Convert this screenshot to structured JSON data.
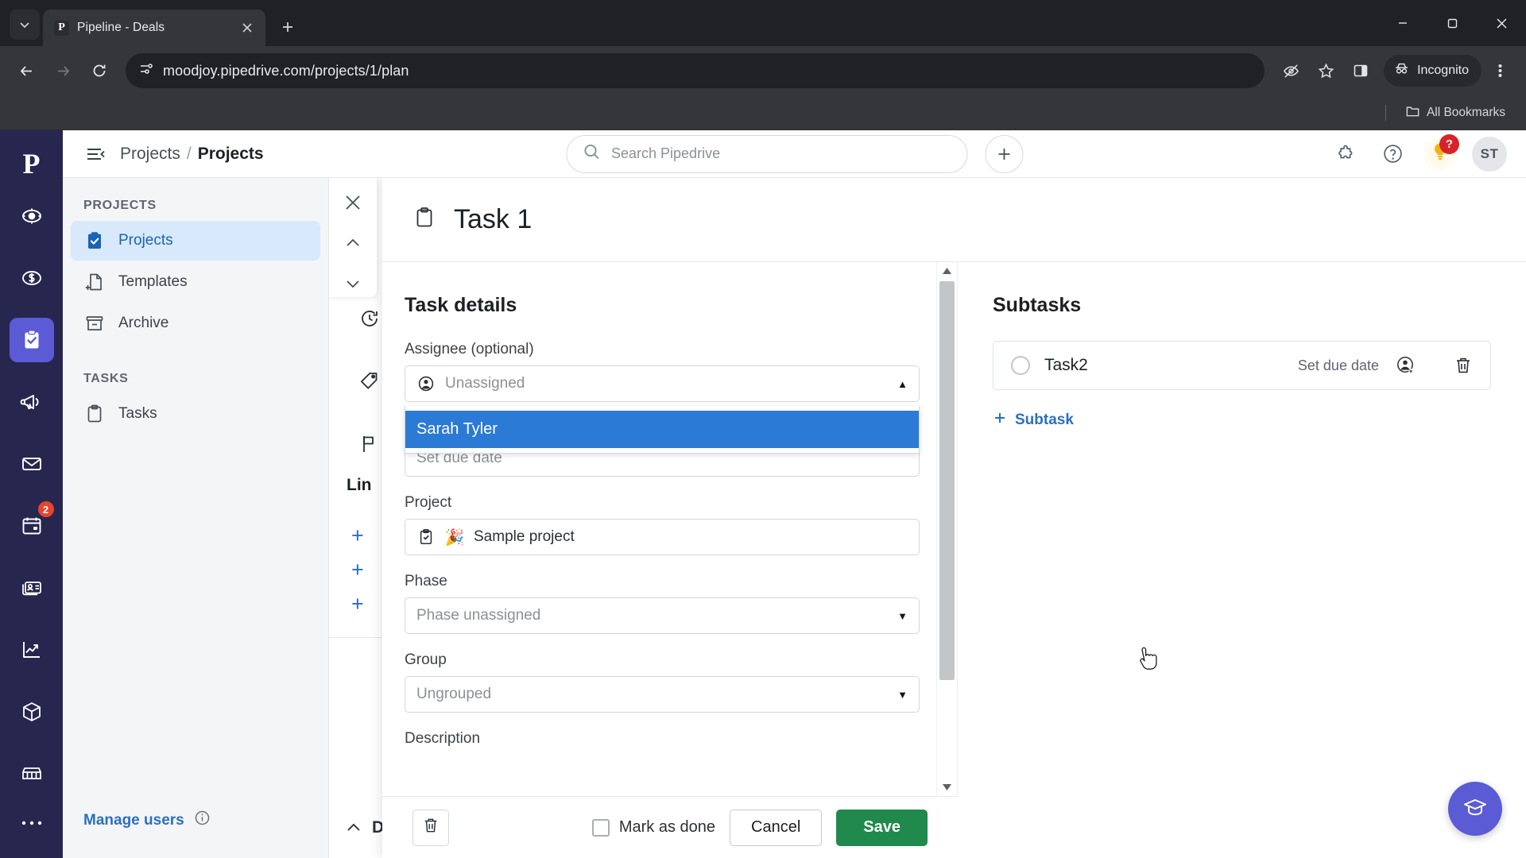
{
  "browser": {
    "tab": {
      "title": "Pipeline - Deals",
      "favicon": "P",
      "favicon_name": "pipedrive-favicon"
    },
    "new_tab_label": "+",
    "url": "moodjoy.pipedrive.com/projects/1/plan",
    "incognito_label": "Incognito",
    "bookmarks": {
      "all_bookmarks_label": "All Bookmarks"
    },
    "icons": {
      "tab_search": "chevron-down-icon",
      "back": "back-arrow-icon",
      "forward": "forward-arrow-icon",
      "reload": "reload-icon",
      "site_info": "site-settings-icon",
      "tracking": "eye-off-icon",
      "bookmark": "star-icon",
      "side_panel": "side-panel-icon",
      "menu": "kebab-menu-icon",
      "minimize": "minimize-icon",
      "maximize": "maximize-icon",
      "close": "window-close-icon"
    }
  },
  "rail": {
    "logo": "P",
    "items": [
      {
        "name": "leads",
        "icon": "target-icon",
        "active": false
      },
      {
        "name": "deals",
        "icon": "dollar-circle-icon",
        "active": false
      },
      {
        "name": "projects",
        "icon": "clipboard-check-icon",
        "active": true
      },
      {
        "name": "campaigns",
        "icon": "megaphone-icon",
        "active": false
      },
      {
        "name": "mail",
        "icon": "envelope-icon",
        "active": false
      },
      {
        "name": "activities",
        "icon": "calendar-icon",
        "active": false,
        "badge": "2"
      },
      {
        "name": "contacts",
        "icon": "contact-card-icon",
        "active": false
      },
      {
        "name": "insights",
        "icon": "line-chart-icon",
        "active": false
      },
      {
        "name": "products",
        "icon": "box-icon",
        "active": false
      },
      {
        "name": "marketplace",
        "icon": "marketplace-icon",
        "active": false
      }
    ],
    "more_label": "more-icon"
  },
  "topbar": {
    "breadcrumb": {
      "parent": "Projects",
      "separator": "/",
      "current": "Projects"
    },
    "search": {
      "placeholder": "Search Pipedrive",
      "icon": "search-icon"
    },
    "add_label": "+",
    "avatar_initials": "ST"
  },
  "nav": {
    "sections": [
      {
        "title": "PROJECTS",
        "items": [
          {
            "label": "Projects",
            "icon": "clipboard-check-icon",
            "active": true
          },
          {
            "label": "Templates",
            "icon": "template-file-icon",
            "active": false
          },
          {
            "label": "Archive",
            "icon": "archive-box-icon",
            "active": false
          }
        ]
      },
      {
        "title": "TASKS",
        "items": [
          {
            "label": "Tasks",
            "icon": "clipboard-icon",
            "active": false
          }
        ]
      }
    ],
    "footer": {
      "label": "Manage users",
      "icon": "info-circle-icon"
    }
  },
  "background": {
    "linked_title": "Lin",
    "icons": [
      "kanban-board-icon",
      "history-clock-icon",
      "tag-icon",
      "flag-icon"
    ],
    "plus_label": "+",
    "collapse_label": "D"
  },
  "modal": {
    "title": "Task 1",
    "title_icon": "clipboard-icon",
    "nav": {
      "close": "close-icon",
      "prev": "chevron-up-icon",
      "next": "chevron-down-icon"
    },
    "details": {
      "heading": "Task details",
      "fields": [
        {
          "label": "Assignee (optional)",
          "value": "Unassigned",
          "icon": "person-circle-icon",
          "control": "dropdown-open"
        },
        {
          "label": "",
          "value": "Set due date",
          "control": "text"
        },
        {
          "label": "Project",
          "value": "Sample project",
          "icon": "clipboard-check-icon",
          "emoji": "🎉",
          "control": "text"
        },
        {
          "label": "Phase",
          "value": "Phase unassigned",
          "control": "dropdown"
        },
        {
          "label": "Group",
          "value": "Ungrouped",
          "control": "dropdown"
        },
        {
          "label": "Description",
          "value": "",
          "control": "text"
        }
      ],
      "assignee_options": [
        {
          "label": "Sarah Tyler",
          "selected": true
        }
      ]
    },
    "subtasks": {
      "heading": "Subtasks",
      "rows": [
        {
          "name": "Task2",
          "due_label": "Set due date",
          "assign_icon": "assign-person-icon",
          "delete_icon": "trash-icon"
        }
      ],
      "add_label": "Subtask",
      "add_icon": "plus-icon"
    },
    "footer": {
      "delete_icon": "trash-icon",
      "mark_done_label": "Mark as done",
      "cancel_label": "Cancel",
      "save_label": "Save"
    }
  },
  "academy": {
    "icon": "graduation-cap-icon"
  },
  "colors": {
    "pipedrive_navy": "#26264f",
    "accent_purple": "#5b5bd6",
    "link_blue": "#2c6fc0",
    "dropdown_selected": "#2b7ad6",
    "save_green": "#1f8a4c",
    "badge_red": "#e8432e"
  }
}
